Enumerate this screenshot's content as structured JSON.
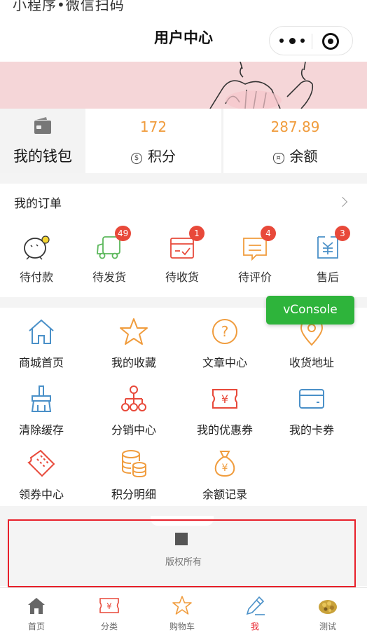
{
  "top_cut_text": "小程序•微信扫码",
  "navbar": {
    "title": "用户中心"
  },
  "wallet": {
    "label": "我的钱包",
    "points": {
      "value": "172",
      "label": "积分"
    },
    "balance": {
      "value": "287.89",
      "label": "余额"
    }
  },
  "orders": {
    "title": "我的订单",
    "items": [
      {
        "label": "待付款",
        "icon": "pending-payment-icon",
        "badge": ""
      },
      {
        "label": "待发货",
        "icon": "truck-icon",
        "badge": "49"
      },
      {
        "label": "待收货",
        "icon": "receive-box-icon",
        "badge": "1"
      },
      {
        "label": "待评价",
        "icon": "comment-icon",
        "badge": "4"
      },
      {
        "label": "售后",
        "icon": "after-sale-icon",
        "badge": "3"
      }
    ]
  },
  "services": {
    "items": [
      {
        "label": "商城首页",
        "icon": "home-icon"
      },
      {
        "label": "我的收藏",
        "icon": "star-icon"
      },
      {
        "label": "文章中心",
        "icon": "question-icon"
      },
      {
        "label": "收货地址",
        "icon": "location-icon"
      },
      {
        "label": "清除缓存",
        "icon": "broom-icon"
      },
      {
        "label": "分销中心",
        "icon": "hierarchy-icon"
      },
      {
        "label": "我的优惠券",
        "icon": "coupon-icon"
      },
      {
        "label": "我的卡券",
        "icon": "card-icon"
      },
      {
        "label": "领券中心",
        "icon": "ticket-icon"
      },
      {
        "label": "积分明细",
        "icon": "coins-icon"
      },
      {
        "label": "余额记录",
        "icon": "money-bag-icon"
      }
    ]
  },
  "vconsole": {
    "label": "vConsole"
  },
  "footer": {
    "copyright": "版权所有"
  },
  "tabbar": {
    "items": [
      {
        "label": "首页",
        "icon": "home-filled-icon"
      },
      {
        "label": "分类",
        "icon": "category-icon"
      },
      {
        "label": "购物车",
        "icon": "cart-star-icon"
      },
      {
        "label": "我",
        "icon": "pen-icon",
        "active": true
      },
      {
        "label": "测试",
        "icon": "food-image-icon"
      }
    ]
  },
  "colors": {
    "accent_orange": "#f09c3d",
    "badge_red": "#e8493a",
    "active_red": "#e8202a",
    "vconsole_green": "#2eb43b",
    "icon_blue": "#4a90c8",
    "icon_green": "#5cb85c",
    "icon_purple": "#8e7cc3"
  }
}
